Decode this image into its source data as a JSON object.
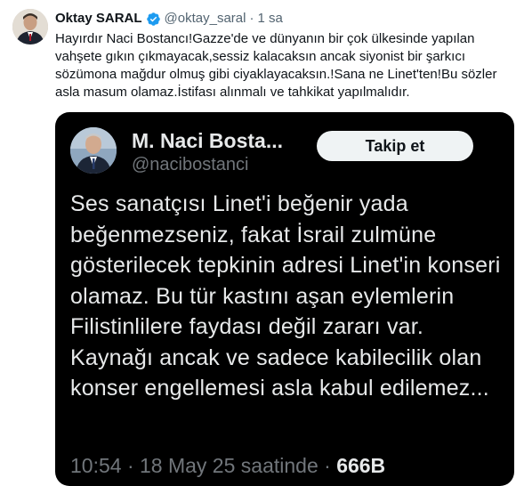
{
  "tweet": {
    "author_name": "Oktay SARAL",
    "handle": "@oktay_saral",
    "separator": "·",
    "time": "1 sa",
    "text": "Hayırdır Naci Bostancı!Gazze'de ve dünyanın bir çok ülkesinde yapılan vahşete gıkın çıkmayacak,sessiz kalacaksın ancak siyonist bir şarkıcı sözümona mağdur olmuş gibi ciyaklayacaksın.!Sana ne Linet'ten!Bu sözler asla masum olamaz.İstifası alınmalı ve tahkikat yapılmalıdır.",
    "verified_color": "#1d9bf0"
  },
  "quoted_screenshot": {
    "author_name": "M. Naci Bosta...",
    "handle": "@nacibostanci",
    "follow_label": "Takip et",
    "body": "Ses sanatçısı Linet'i beğenir yada beğenmezseniz, fakat İsrail zulmüne gösterilecek tepkinin adresi Linet'in konseri olamaz. Bu tür kastını aşan eylemlerin Filistinlilere faydası değil zararı var. Kaynağı ancak ve sadece kabilecilik olan konser engellemesi asla kabul edilemez...",
    "meta_time": "10:54 · 18 May 25 saatinde · ",
    "meta_views": "666B"
  }
}
